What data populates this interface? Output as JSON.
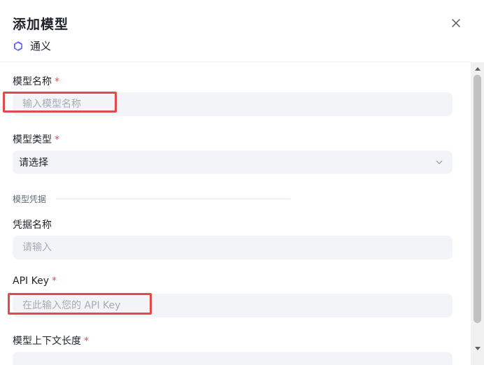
{
  "dialog": {
    "title": "添加模型",
    "provider": {
      "name": "通义",
      "icon": "tongyi-logo-icon"
    },
    "close_icon": "close-icon"
  },
  "form": {
    "model_name": {
      "label": "模型名称",
      "required_mark": "*",
      "placeholder": "输入模型名称",
      "value": ""
    },
    "model_type": {
      "label": "模型类型",
      "required_mark": "*",
      "value": "请选择"
    },
    "credentials_section": {
      "label": "模型凭据"
    },
    "credential_name": {
      "label": "凭据名称",
      "placeholder": "请输入",
      "value": ""
    },
    "api_key": {
      "label": "API Key",
      "required_mark": "*",
      "placeholder": "在此输入您的 API Key",
      "value": ""
    },
    "context_length": {
      "label": "模型上下文长度",
      "required_mark": "*"
    }
  },
  "colors": {
    "highlight": "#e04a4a",
    "required": "#f54a45",
    "field_bg": "#f3f4f7",
    "brand": "#5b5bd6"
  }
}
